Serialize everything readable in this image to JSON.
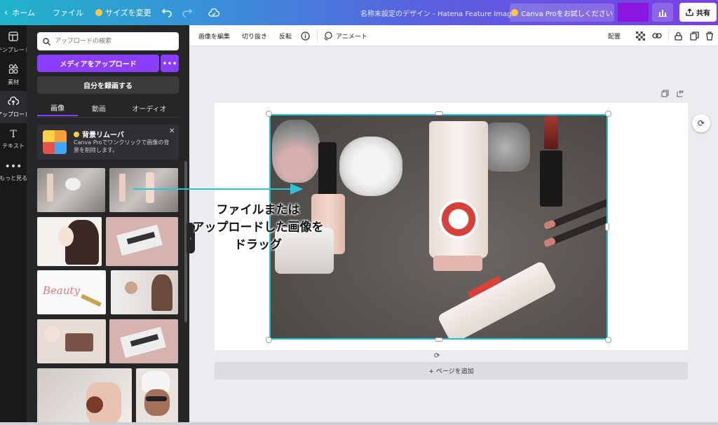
{
  "topbar": {
    "home": "ホーム",
    "file": "ファイル",
    "resize": "サイズを変更",
    "doc_title": "名称未設定のデザイン - Hatena Feature Image",
    "pro_button": "Canva Proをお試しください",
    "share": "共有"
  },
  "rail": {
    "items": [
      {
        "label": "テンプレート",
        "icon": "template-icon"
      },
      {
        "label": "素材",
        "icon": "elements-icon"
      },
      {
        "label": "アップロード",
        "icon": "upload-cloud-icon"
      },
      {
        "label": "テキスト",
        "icon": "text-icon"
      },
      {
        "label": "もっと見る",
        "icon": "more-icon"
      }
    ]
  },
  "panel": {
    "search_placeholder": "アップロードの検索",
    "upload_button": "メディアをアップロード",
    "record_button": "自分を録画する",
    "tabs": [
      "画像",
      "動画",
      "オーディオ"
    ],
    "promo": {
      "title": "背景リムーバ",
      "desc": "Canva Proでワンクリックで画像の背景を削除します。"
    }
  },
  "toolbar": {
    "edit_image": "画像を編集",
    "crop": "切り抜き",
    "flip": "反転",
    "animate": "アニメート",
    "arrange": "配置"
  },
  "canvas": {
    "add_page": "+ ページを追加"
  },
  "annotation": {
    "line1": "ファイルまたは",
    "line2": "アップロードした画像を",
    "line3": "ドラッグ",
    "arrow_color": "#2ec4d6"
  },
  "colors": {
    "accent": "#8b3dff",
    "selection": "#21c4d6"
  }
}
